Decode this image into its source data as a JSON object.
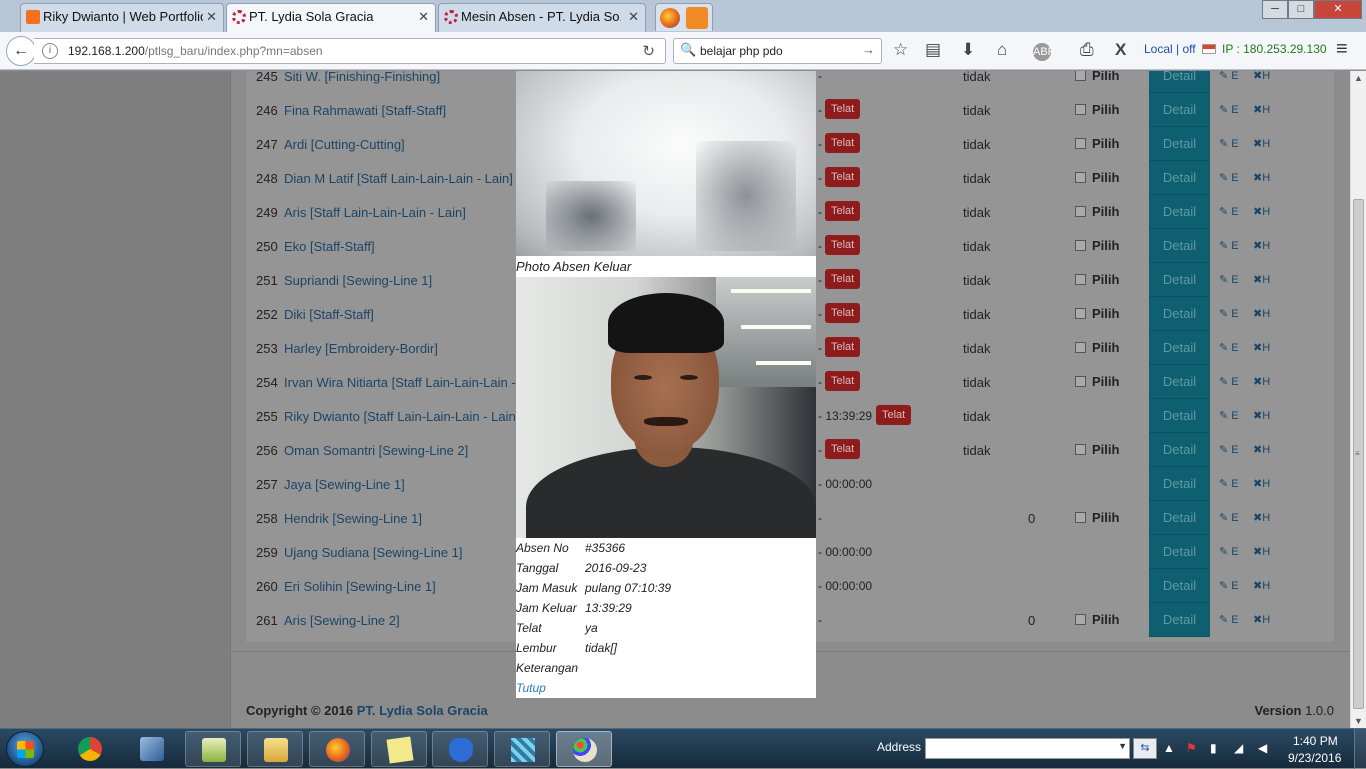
{
  "browser": {
    "tabs": [
      {
        "title": "Riky Dwianto | Web Portfolio",
        "icon": "xampp-icon",
        "active": false
      },
      {
        "title": "PT. Lydia Sola Gracia",
        "icon": "spinner-icon",
        "active": true
      },
      {
        "title": "Mesin Absen - PT. Lydia So...",
        "icon": "spinner-icon",
        "active": false
      }
    ],
    "url_host": "192.168.1.200",
    "url_path": "/ptlsg_baru/index.php?mn=absen",
    "search_value": "belajar php pdo",
    "local_status": "Local | off",
    "ip_text": "IP : 180.253.29.130",
    "window_controls": {
      "minimize": "─",
      "maximize": "□",
      "close": "✕"
    }
  },
  "table": {
    "rows": [
      {
        "no": "245",
        "name": "Siti W. [Finishing-Finishing]",
        "time": "-",
        "telat": false,
        "lembur": "tidak",
        "zero": "",
        "pilih": true
      },
      {
        "no": "246",
        "name": "Fina Rahmawati [Staff-Staff]",
        "time": "-",
        "telat": true,
        "lembur": "tidak",
        "zero": "",
        "pilih": true
      },
      {
        "no": "247",
        "name": "Ardi [Cutting-Cutting]",
        "time": "-",
        "telat": true,
        "lembur": "tidak",
        "zero": "",
        "pilih": true
      },
      {
        "no": "248",
        "name": "Dian M Latif [Staff Lain-Lain-Lain - Lain]",
        "time": "-",
        "telat": true,
        "lembur": "tidak",
        "zero": "",
        "pilih": true
      },
      {
        "no": "249",
        "name": "Aris [Staff Lain-Lain-Lain - Lain]",
        "time": "-",
        "telat": true,
        "lembur": "tidak",
        "zero": "",
        "pilih": true
      },
      {
        "no": "250",
        "name": "Eko [Staff-Staff]",
        "time": "-",
        "telat": true,
        "lembur": "tidak",
        "zero": "",
        "pilih": true
      },
      {
        "no": "251",
        "name": "Supriandi [Sewing-Line 1]",
        "time": "-",
        "telat": true,
        "lembur": "tidak",
        "zero": "",
        "pilih": true
      },
      {
        "no": "252",
        "name": "Diki [Staff-Staff]",
        "time": "-",
        "telat": true,
        "lembur": "tidak",
        "zero": "",
        "pilih": true
      },
      {
        "no": "253",
        "name": "Harley [Embroidery-Bordir]",
        "time": "-",
        "telat": true,
        "lembur": "tidak",
        "zero": "",
        "pilih": true
      },
      {
        "no": "254",
        "name": "Irvan Wira Nitiarta [Staff Lain-Lain-Lain - Lain]",
        "time": "-",
        "telat": true,
        "lembur": "tidak",
        "zero": "",
        "pilih": true
      },
      {
        "no": "255",
        "name": "Riky Dwianto [Staff Lain-Lain-Lain - Lain]",
        "time": "- 13:39:29",
        "telat": true,
        "lembur": "tidak",
        "zero": "",
        "pilih": false
      },
      {
        "no": "256",
        "name": "Oman Somantri [Sewing-Line 2]",
        "time": "-",
        "telat": true,
        "lembur": "tidak",
        "zero": "",
        "pilih": true
      },
      {
        "no": "257",
        "name": "Jaya [Sewing-Line 1]",
        "time": "- 00:00:00",
        "telat": false,
        "lembur": "",
        "zero": "",
        "pilih": false
      },
      {
        "no": "258",
        "name": "Hendrik [Sewing-Line 1]",
        "time": "-",
        "telat": false,
        "lembur": "",
        "zero": "0",
        "pilih": true
      },
      {
        "no": "259",
        "name": "Ujang Sudiana [Sewing-Line 1]",
        "time": "- 00:00:00",
        "telat": false,
        "lembur": "",
        "zero": "",
        "pilih": false
      },
      {
        "no": "260",
        "name": "Eri Solihin [Sewing-Line 1]",
        "time": "- 00:00:00",
        "telat": false,
        "lembur": "",
        "zero": "",
        "pilih": false
      },
      {
        "no": "261",
        "name": "Aris [Sewing-Line 2]",
        "time": "-",
        "telat": false,
        "lembur": "",
        "zero": "0",
        "pilih": true
      }
    ],
    "telat_label": "Telat",
    "pilih_label": "Pilih",
    "detail_label": "Detail",
    "edit_label": "E",
    "hapus_label": "H"
  },
  "modal": {
    "caption": "Photo Absen Keluar",
    "fields": [
      {
        "label": "Absen No",
        "value": "#35366"
      },
      {
        "label": "Tanggal",
        "value": "2016-09-23"
      },
      {
        "label": "Jam Masuk",
        "value": "pulang 07:10:39"
      },
      {
        "label": "Jam Keluar",
        "value": "13:39:29"
      },
      {
        "label": "Telat",
        "value": "ya"
      },
      {
        "label": "Lembur",
        "value": "tidak[]"
      },
      {
        "label": "Keterangan",
        "value": ""
      }
    ],
    "close_label": "Tutup"
  },
  "footer": {
    "copyright_prefix": "Copyright © 2016",
    "company": "PT. Lydia Sola Gracia",
    "version_label": "Version",
    "version": "1.0.0"
  },
  "taskbar": {
    "address_label": "Address",
    "time": "1:40 PM",
    "date": "9/23/2016"
  }
}
